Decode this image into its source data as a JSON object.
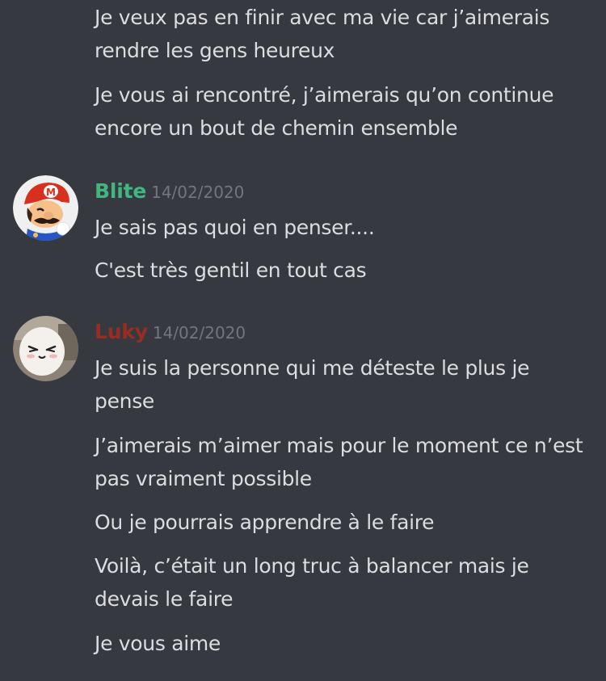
{
  "theme": {
    "background": "#36393f",
    "text": "#dcddde",
    "timestamp": "#72767d"
  },
  "continuation": {
    "lines": [
      "Je veux pas en finir avec ma vie car j’aimerais rendre les gens heureux",
      "Je vous ai rencontré, j’aimerais qu’on continue encore un bout de chemin ensemble"
    ]
  },
  "groups": [
    {
      "author": "Blite",
      "author_color": "#43b581",
      "timestamp": "14/02/2020",
      "avatar_icon": "mario-avatar-icon",
      "lines": [
        "Je sais pas quoi en penser....",
        "C'est très gentil en tout cas"
      ]
    },
    {
      "author": "Luky",
      "author_color": "#992d22",
      "timestamp": "14/02/2020",
      "avatar_icon": "mug-avatar-icon",
      "lines": [
        "Je suis la personne qui me déteste le plus je pense",
        "J’aimerais m’aimer mais pour le moment ce n’est pas vraiment possible",
        "Ou je pourrais apprendre à le faire",
        "Voilà, c’était un long truc à balancer mais je devais le faire",
        "Je vous aime"
      ]
    }
  ]
}
